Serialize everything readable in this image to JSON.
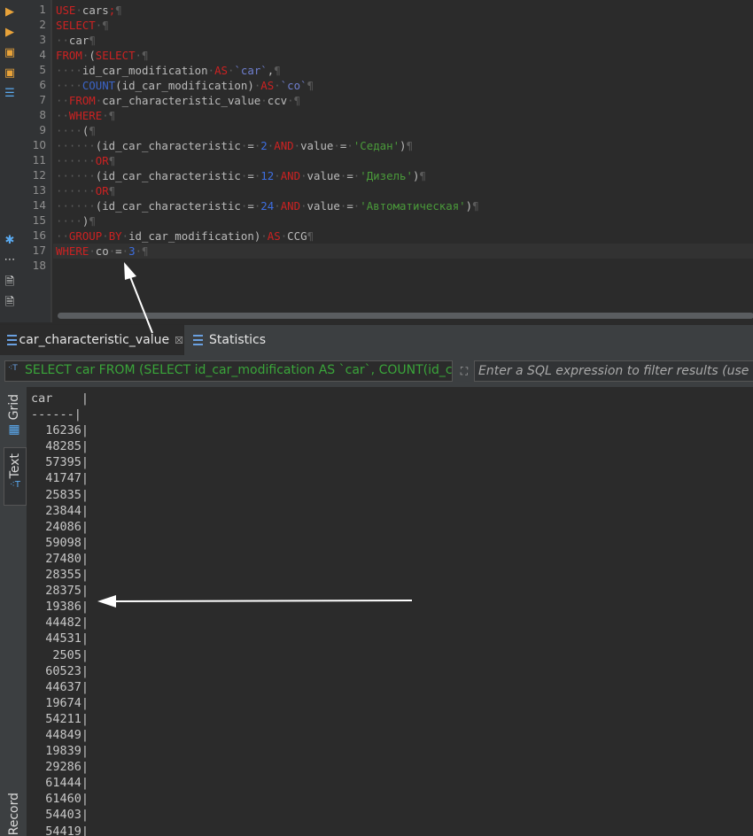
{
  "toolbar": {
    "icons": [
      "run-icon",
      "run-plus-icon",
      "execute-script-icon",
      "execute-script-plus-icon",
      "explain-icon",
      "settings-icon",
      "more-icon",
      "export-icon",
      "export-pdf-icon"
    ]
  },
  "editor": {
    "line_numbers": [
      "1",
      "2",
      "3",
      "4",
      "5",
      "6",
      "7",
      "8",
      "9",
      "10",
      "11",
      "12",
      "13",
      "14",
      "15",
      "16",
      "17",
      "18"
    ]
  },
  "tabs": [
    {
      "label": "car_characteristic_value",
      "close": "☒"
    },
    {
      "label": "Statistics"
    }
  ],
  "filter": {
    "query_text": "SELECT car FROM (SELECT id_car_modification AS `car`, COUNT(id_car_modification) AS `co` FROM car_characteristic_value ccv",
    "placeholder": "Enter a SQL expression to filter results (use Ctrl+Space)"
  },
  "side_tabs": [
    "Grid",
    "Text",
    "Record"
  ],
  "results": {
    "header": "car    |",
    "separator": "------|",
    "rows": [
      "  16236|",
      "  48285|",
      "  57395|",
      "  41747|",
      "  25835|",
      "  23844|",
      "  24086|",
      "  59098|",
      "  27480|",
      "  28355|",
      "  28375|",
      "  19386|",
      "  44482|",
      "  44531|",
      "   2505|",
      "  60523|",
      "  44637|",
      "  19674|",
      "  54211|",
      "  44849|",
      "  19839|",
      "  29286|",
      "  61444|",
      "  61460|",
      "  54403|",
      "  54419|"
    ]
  },
  "colors": {
    "keyword": "#cc2222",
    "function": "#3b64c8",
    "string": "#4a9a3a",
    "query": "#3aa53a"
  }
}
